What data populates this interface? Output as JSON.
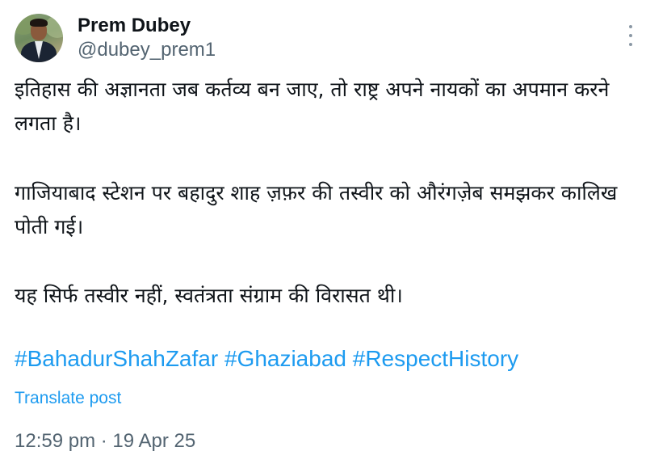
{
  "author": {
    "name": "Prem Dubey",
    "handle": "@dubey_prem1",
    "avatar_icon": "profile-photo"
  },
  "post": {
    "paragraphs": [
      "इतिहास की अज्ञानता जब कर्तव्य बन जाए, तो राष्ट्र अपने नायकों का अपमान करने लगता है।",
      "गाजियाबाद स्टेशन पर बहादुर शाह ज़फ़र की तस्वीर को औरंगज़ेब समझकर कालिख पोती गई।",
      "यह सिर्फ तस्वीर नहीं, स्वतंत्रता संग्राम की विरासत थी।"
    ],
    "hashtags": [
      "#BahadurShahZafar",
      "#Ghaziabad",
      "#RespectHistory"
    ],
    "translate_label": "Translate post",
    "time": "12:59 pm",
    "separator": "·",
    "date": "19 Apr 25"
  },
  "menu_icon": "more-vertical-icon",
  "colors": {
    "link": "#1d9bf0",
    "text": "#0f1419",
    "secondary": "#536471"
  }
}
